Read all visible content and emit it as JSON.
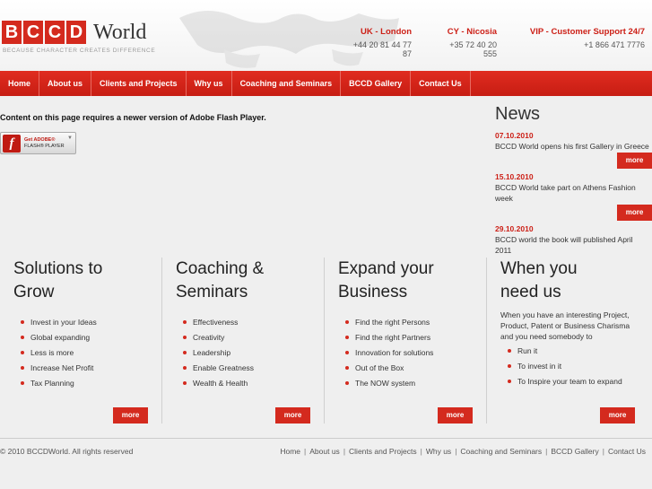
{
  "header": {
    "logo_letters": [
      "B",
      "C",
      "C",
      "D"
    ],
    "logo_word": "World",
    "tagline": "BECAUSE CHARACTER CREATES DIFFERENCE",
    "contacts": [
      {
        "city": "UK - London",
        "phone": "+44 20 81 44 77 87"
      },
      {
        "city": "CY - Nicosia",
        "phone": "+35 72 40 20 555"
      },
      {
        "city": "VIP - Customer Support 24/7",
        "phone": "+1 866 471 7776"
      }
    ]
  },
  "nav": {
    "items": [
      "Home",
      "About us",
      "Clients and Projects",
      "Why us",
      "Coaching and Seminars",
      "BCCD Gallery",
      "Contact Us"
    ]
  },
  "flash": {
    "message": "Content on this page requires a newer version of Adobe Flash Player.",
    "button_line1": "Get ADOBE®",
    "button_line2": "FLASH® PLAYER",
    "icon_letter": "f"
  },
  "news": {
    "title": "News",
    "items": [
      {
        "date": "07.10.2010",
        "text": "BCCD World opens his first Gallery in Greece",
        "more": "more"
      },
      {
        "date": "15.10.2010",
        "text": "BCCD World  take part on Athens Fashion week",
        "more": "more"
      },
      {
        "date": "29.10.2010",
        "text": "BCCD world the book will published April 2011"
      }
    ]
  },
  "columns": [
    {
      "title_line1": "Solutions to",
      "title_line2": "Grow",
      "items": [
        "Invest in your Ideas",
        "Global expanding",
        "Less is more",
        "Increase Net Profit",
        "Tax Planning"
      ],
      "more": "more"
    },
    {
      "title_line1": "Coaching &",
      "title_line2": "Seminars",
      "items": [
        "Effectiveness",
        "Creativity",
        "Leadership",
        "Enable Greatness",
        "Wealth & Health"
      ],
      "more": "more"
    },
    {
      "title_line1": "Expand your",
      "title_line2": "Business",
      "items": [
        "Find the right Persons",
        "Find the right Partners",
        "Innovation for solutions",
        "Out of the Box",
        "The NOW system"
      ],
      "more": "more"
    },
    {
      "title_line1": "When you",
      "title_line2": "need us",
      "intro": "When you have an interesting Project, Product, Patent or Business Charisma and you need somebody to",
      "items": [
        "Run it",
        "To invest in it",
        "To Inspire your team to expand"
      ],
      "more": "more"
    }
  ],
  "footer": {
    "copyright": "© 2010 BCCDWorld. All rights reserved",
    "links": [
      "Home",
      "About us",
      "Clients and Projects",
      "Why us",
      "Coaching and Seminars",
      "BCCD Gallery",
      "Contact Us"
    ],
    "separator": "|"
  },
  "colors": {
    "brand_red": "#d42a1e",
    "accent_red_text": "#cc1f16"
  }
}
